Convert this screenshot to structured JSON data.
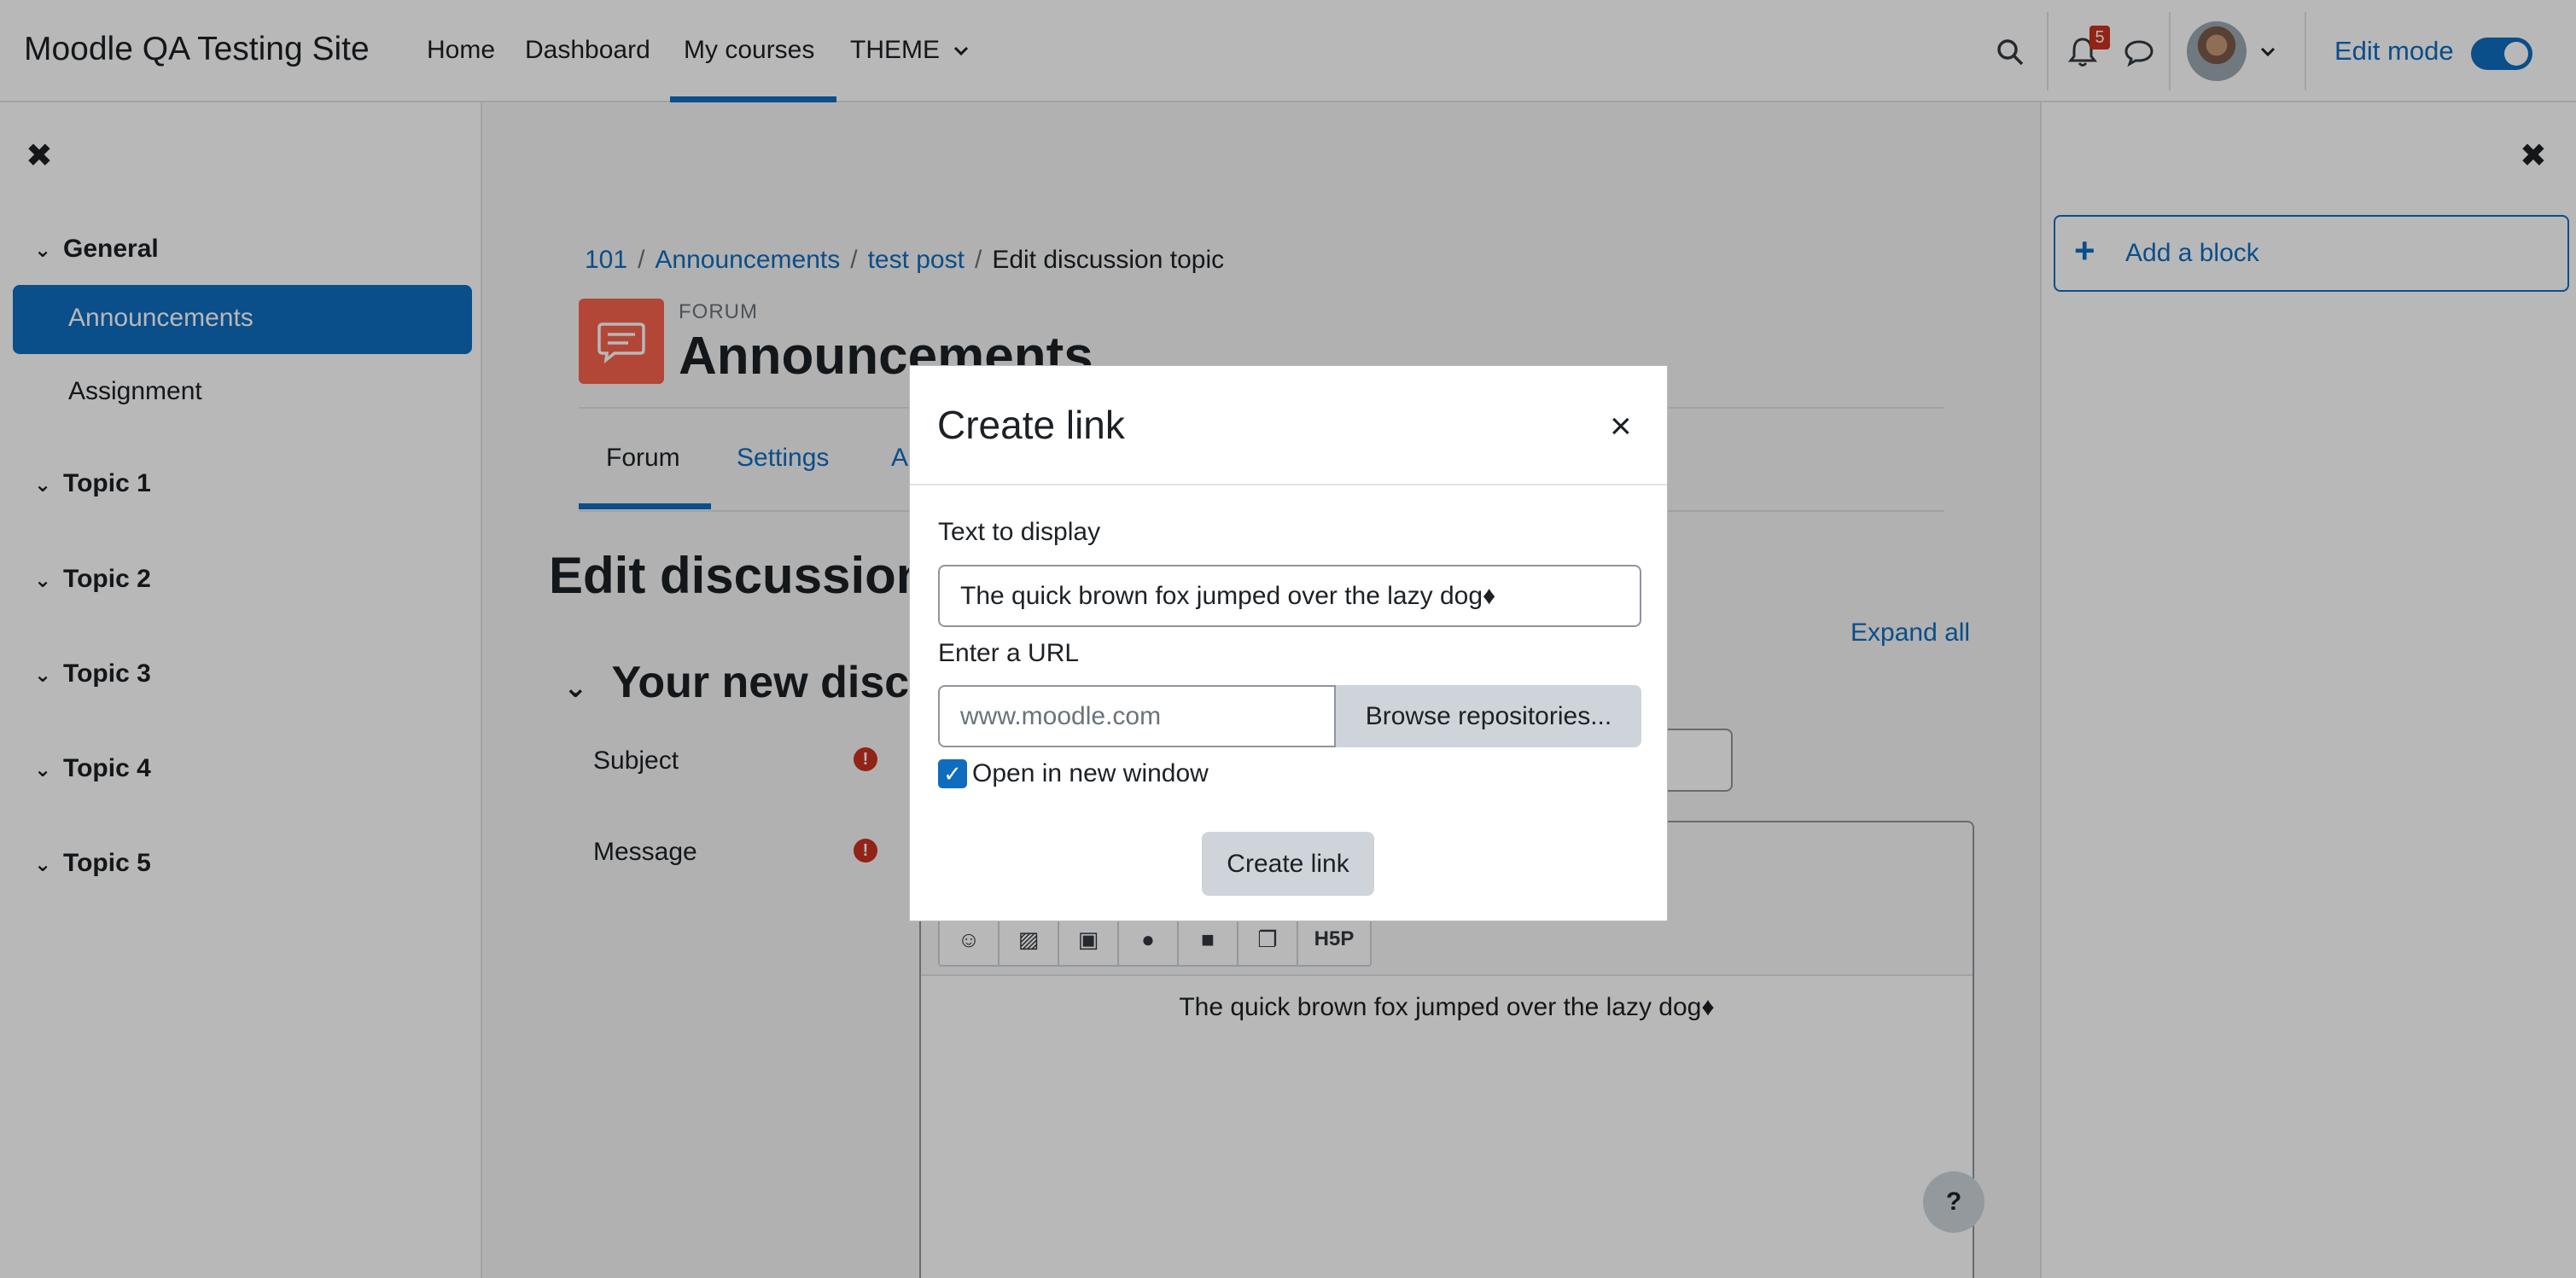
{
  "navbar": {
    "brand": "Moodle QA Testing Site",
    "items": [
      "Home",
      "Dashboard",
      "My courses",
      "THEME"
    ],
    "notification_count": "5",
    "edit_mode_label": "Edit mode",
    "edit_mode_on": true
  },
  "left_drawer": {
    "sections": [
      {
        "label": "General",
        "items": [
          "Announcements",
          "Assignment"
        ]
      },
      {
        "label": "Topic 1"
      },
      {
        "label": "Topic 2"
      },
      {
        "label": "Topic 3"
      },
      {
        "label": "Topic 4"
      },
      {
        "label": "Topic 5"
      }
    ],
    "active_item": "Announcements"
  },
  "breadcrumb": [
    "101",
    "Announcements",
    "test post",
    "Edit discussion topic"
  ],
  "activity": {
    "type_label": "FORUM",
    "title": "Announcements"
  },
  "tabs": [
    "Forum",
    "Settings",
    "A"
  ],
  "page_heading": "Edit discussion",
  "expand_all": "Expand all",
  "fieldset_heading": "Your new disc",
  "form": {
    "subject_label": "Subject",
    "message_label": "Message",
    "required_glyph": "!",
    "editor_text": "The quick brown fox jumped over the lazy dog♦",
    "h5p_button": "H5P"
  },
  "help_label": "?",
  "right_drawer": {
    "add_block": "Add a block"
  },
  "modal": {
    "title": "Create link",
    "close": "×",
    "text_label": "Text to display",
    "text_value": "The quick brown fox jumped over the lazy dog♦",
    "url_label": "Enter a URL",
    "url_placeholder": "www.moodle.com",
    "browse_button": "Browse repositories...",
    "open_new_window_label": "Open in new window",
    "open_new_window_checked": true,
    "create_button": "Create link"
  },
  "colors": {
    "primary": "#0f6cbf",
    "forum_icon": "#f7634d",
    "danger": "#ca3120"
  }
}
